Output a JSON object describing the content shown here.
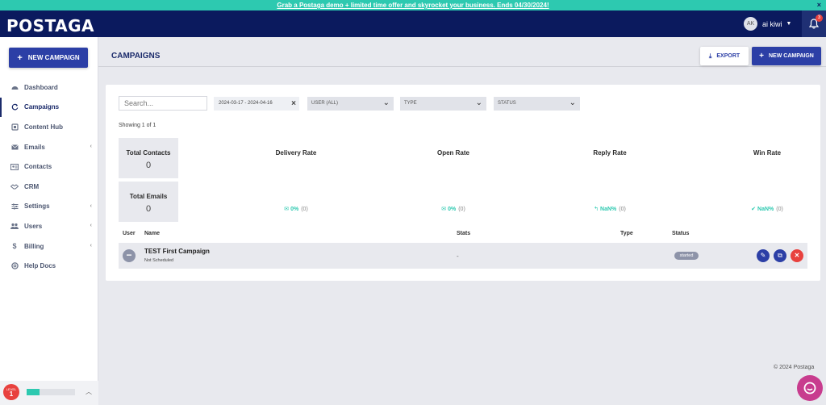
{
  "promo": {
    "text": "Grab a Postaga demo + limited time offer and skyrocket your business. Ends 04/30/2024!",
    "close": "×"
  },
  "header": {
    "logo": "POSTAGA",
    "user_initials": "AK",
    "user_name": "ai kiwi",
    "notifications": "3"
  },
  "sidebar": {
    "new_campaign": "NEW CAMPAIGN",
    "items": [
      {
        "label": "Dashboard",
        "icon": "dashboard-icon",
        "chevron": ""
      },
      {
        "label": "Campaigns",
        "icon": "refresh-icon",
        "chevron": ""
      },
      {
        "label": "Content Hub",
        "icon": "content-hub-icon",
        "chevron": ""
      },
      {
        "label": "Emails",
        "icon": "envelope-icon",
        "chevron": "‹"
      },
      {
        "label": "Contacts",
        "icon": "contact-card-icon",
        "chevron": ""
      },
      {
        "label": "CRM",
        "icon": "handshake-icon",
        "chevron": ""
      },
      {
        "label": "Settings",
        "icon": "sliders-icon",
        "chevron": "‹"
      },
      {
        "label": "Users",
        "icon": "users-icon",
        "chevron": "‹"
      },
      {
        "label": "Billing",
        "icon": "dollar-icon",
        "chevron": "‹"
      },
      {
        "label": "Help Docs",
        "icon": "lifebuoy-icon",
        "chevron": ""
      }
    ],
    "active_item": "Campaigns",
    "level_label": "LEVEL",
    "level_number": "1",
    "level_progress": 0.27
  },
  "page": {
    "title": "CAMPAIGNS",
    "export": "EXPORT",
    "new_campaign": "NEW CAMPAIGN"
  },
  "filters": {
    "search_placeholder": "Search...",
    "date_range": "2024-03-17 - 2024-04-16",
    "user": "USER (ALL)",
    "type": "TYPE",
    "status": "STATUS"
  },
  "showing": "Showing 1 of 1",
  "stats": {
    "total_contacts_label": "Total Contacts",
    "total_contacts": "0",
    "total_emails_label": "Total Emails",
    "total_emails": "0",
    "rates": [
      {
        "label": "Delivery Rate",
        "value": "0%",
        "count": "(0)",
        "icon": "✉"
      },
      {
        "label": "Open Rate",
        "value": "0%",
        "count": "(0)",
        "icon": "✉"
      },
      {
        "label": "Reply Rate",
        "value": "NaN%",
        "count": "(0)",
        "icon": "↰"
      },
      {
        "label": "Win Rate",
        "value": "NaN%",
        "count": "(0)",
        "icon": "✔"
      }
    ]
  },
  "table": {
    "headers": {
      "user": "User",
      "name": "Name",
      "stats": "Stats",
      "type": "Type",
      "status": "Status"
    },
    "rows": [
      {
        "name": "TEST First Campaign",
        "schedule": "Not Scheduled",
        "stats": "-",
        "type": "",
        "status": "started"
      }
    ]
  },
  "footer": {
    "copyright": "© 2024 Postaga"
  },
  "colors": {
    "navy": "#0b1a5e",
    "primary": "#2c3fa6",
    "teal": "#2dc9b0",
    "danger": "#e8413e",
    "chat": "#c83c8e"
  }
}
